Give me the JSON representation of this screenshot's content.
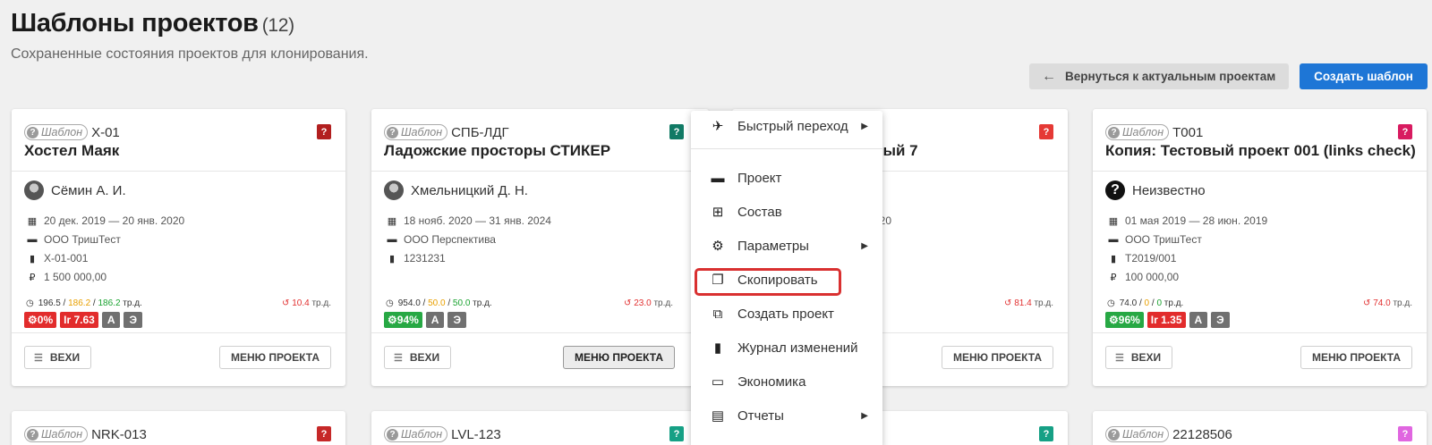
{
  "page": {
    "title": "Шаблоны проектов",
    "count": "(12)",
    "subtitle": "Сохраненные состояния проектов для клонирования.",
    "back_label": "Вернуться к актуальным проектам",
    "create_label": "Создать шаблон"
  },
  "tpl_label": "Шаблон",
  "currency": "₽",
  "units": "тр.д.",
  "milestones_label": "ВЕХИ",
  "project_menu_label": "МЕНЮ ПРОЕКТА",
  "cards": [
    {
      "code": "X-01",
      "title": "Хостел Маяк",
      "flag_color": "#b21f1f",
      "owner": "Сёмин А. И.",
      "dates": "20 дек. 2019 — 20 янв. 2020",
      "org": "ООО ТришТест",
      "doc": "X-01-001",
      "budget": "1 500 000,00",
      "stat_a": "196.5",
      "stat_b": "186.2",
      "stat_c": "186.2",
      "overdue": "10.4",
      "b_pct": "0%",
      "b_ir": "Ir 7.63",
      "b_a": "A",
      "b_e": "Э"
    },
    {
      "code": "СПБ-ЛДГ",
      "title": "Ладожские просторы СТИКЕР",
      "flag_color": "#117a65",
      "owner": "Хмельницкий Д. Н.",
      "dates": "18 нояб. 2020 — 31 янв. 2024",
      "org": "ООО Перспектива",
      "doc": "1231231",
      "stat_a": "954.0",
      "stat_b": "50.0",
      "stat_c": "50.0",
      "overdue": "23.0",
      "b_pct": "94%",
      "b_a": "A",
      "b_e": "Э"
    },
    {
      "title_tail": "вый 7",
      "dates_tail": "020",
      "overdue": "81.4",
      "flag_color": "#e53935"
    },
    {
      "code": "T001",
      "title": "Копия: Тестовый проект 001 (links check)",
      "flag_color": "#d81b60",
      "owner": "Неизвестно",
      "dates": "01 мая 2019 — 28 июн. 2019",
      "org": "ООО ТришТест",
      "doc": "T2019/001",
      "budget": "100 000,00",
      "stat_a": "74.0",
      "stat_b": "0",
      "stat_c": "0",
      "overdue": "74.0",
      "b_pct": "96%",
      "b_ir": "Ir 1.35",
      "b_a": "A",
      "b_e": "Э"
    }
  ],
  "second_row": [
    {
      "code": "NRK-013",
      "flag_color": "#c62828"
    },
    {
      "code": "LVL-123",
      "flag_color": "#16a085"
    },
    {
      "flag_color": "#16a085"
    },
    {
      "code": "22128506",
      "flag_color": "#e066e0"
    }
  ],
  "context_menu": {
    "quick": "Быстрый переход",
    "project": "Проект",
    "structure": "Состав",
    "params": "Параметры",
    "copy": "Скопировать",
    "create_project": "Создать проект",
    "changelog": "Журнал изменений",
    "economics": "Экономика",
    "reports": "Отчеты"
  }
}
